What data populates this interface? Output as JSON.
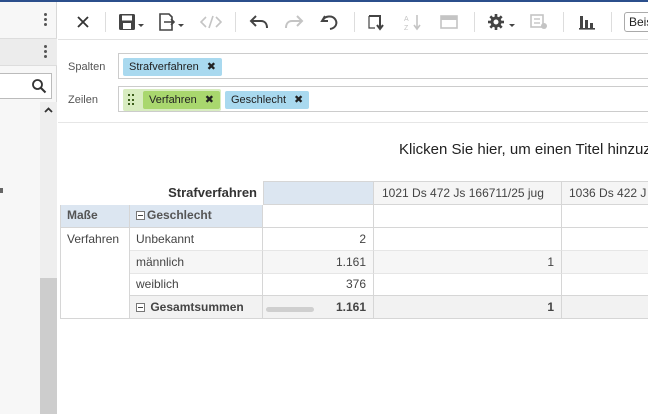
{
  "colors": {
    "header_blue": "#dce6f1",
    "chip_blue": "#a9d9ef",
    "chip_green": "#a9d76e",
    "accent": "#2b4f8c"
  },
  "toolbar": {
    "icons": [
      "close-icon",
      "save-icon",
      "export-icon",
      "code-icon",
      "undo-icon",
      "redo-icon",
      "revert-icon",
      "swap-axes-icon",
      "sort-icon",
      "layout-icon",
      "settings-icon",
      "filter-settings-icon",
      "chart-icon"
    ],
    "lang_value": "Beis"
  },
  "filters": {
    "columns_label": "Spalten",
    "rows_label": "Zeilen",
    "columns_chips": [
      {
        "label": "Strafverfahren",
        "remove": "✖"
      }
    ],
    "rows_chips": [
      {
        "label": "Verfahren",
        "remove": "✖"
      },
      {
        "label": "Geschlecht",
        "remove": "✖"
      }
    ]
  },
  "pivot": {
    "title": "Klicken Sie hier, um einen Titel hinzuz",
    "column_dimension": "Strafverfahren",
    "column_headers": [
      "",
      "1021 Ds 472 Js 166711/25 jug",
      "1036 Ds 422 J"
    ],
    "measures_label": "Maße",
    "row_dimension": "Geschlecht",
    "measure_name": "Verfahren",
    "rows": [
      {
        "label": "Unbekannt",
        "values": [
          "2",
          "",
          ""
        ]
      },
      {
        "label": "männlich",
        "values": [
          "1.161",
          "1",
          ""
        ]
      },
      {
        "label": "weiblich",
        "values": [
          "376",
          "",
          ""
        ]
      }
    ],
    "total": {
      "label": "Gesamtsummen",
      "values": [
        "1.161",
        "1",
        ""
      ]
    }
  }
}
